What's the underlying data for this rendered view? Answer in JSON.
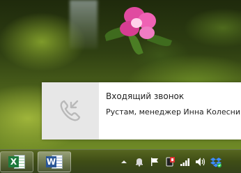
{
  "notification": {
    "title": "Входящий звонок",
    "body": "Рустам, менеджер Инна Колеснико",
    "icon": "phone-handset-icon"
  },
  "taskbar": {
    "apps": [
      {
        "name": "Excel",
        "icon": "excel-icon",
        "badge": "X"
      },
      {
        "name": "Word",
        "icon": "word-icon",
        "badge": "W"
      }
    ],
    "tray_icons": [
      "show-hidden-icons-chevron",
      "notification-bell-icon",
      "action-center-flag-icon",
      "app-tray-icon",
      "network-signal-icon",
      "volume-icon",
      "dropbox-icon"
    ]
  },
  "colors": {
    "toast_background": "#ffffff",
    "toast_icon_area": "#e7e7e7",
    "taskbar": "#3f4d16",
    "excel_green": "#1f7a3c",
    "word_blue": "#2b5797"
  }
}
